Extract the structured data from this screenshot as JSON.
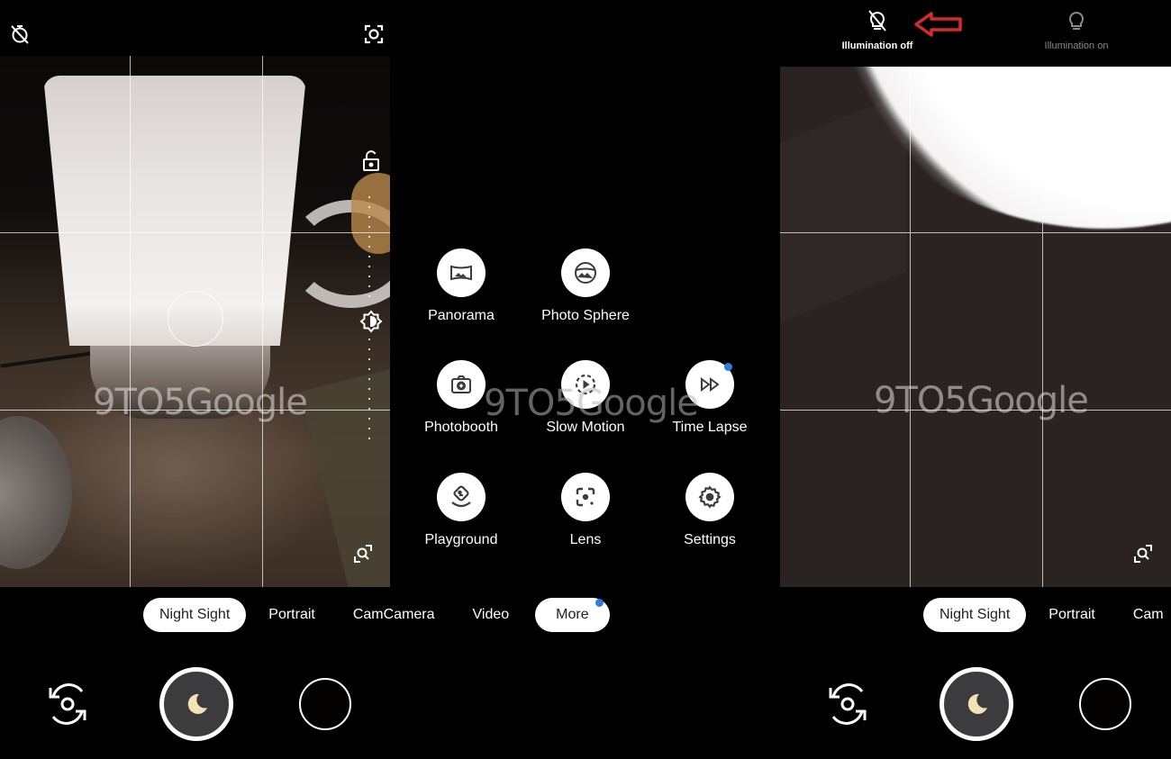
{
  "watermark": "9TO5Google",
  "left_panel": {
    "top_icons": [
      "timer-off-icon",
      "lens-scan-icon"
    ],
    "side_icons": [
      "exposure-lock-icon",
      "brightness-icon",
      "zoom-search-icon"
    ]
  },
  "more_panel": {
    "modes": [
      {
        "label": "Panorama",
        "icon": "panorama-icon",
        "new_badge": false
      },
      {
        "label": "Photo Sphere",
        "icon": "photo-sphere-icon",
        "new_badge": false
      },
      {
        "label": "Photobooth",
        "icon": "photobooth-icon",
        "new_badge": false
      },
      {
        "label": "Slow Motion",
        "icon": "slow-motion-icon",
        "new_badge": false
      },
      {
        "label": "Time Lapse",
        "icon": "time-lapse-icon",
        "new_badge": true
      },
      {
        "label": "Playground",
        "icon": "playground-icon",
        "new_badge": false
      },
      {
        "label": "Lens",
        "icon": "lens-icon",
        "new_badge": false
      },
      {
        "label": "Settings",
        "icon": "settings-icon",
        "new_badge": false
      }
    ]
  },
  "mode_tabs": {
    "items": [
      "Night Sight",
      "Portrait",
      "CamCamera",
      "Video",
      "More"
    ],
    "active": "Night Sight",
    "more_has_badge": true
  },
  "right_panel": {
    "illumination_off_label": "Illumination off",
    "illumination_on_label": "Illumination on",
    "selected": "Illumination off",
    "mode_tabs": [
      "Night Sight",
      "Portrait",
      "Cam"
    ]
  },
  "colors": {
    "accent_blue": "#2f7bdf",
    "annotation_red": "#d62a2a",
    "moon": "#f3e2b5",
    "shutter_fill": "#3c3c3e"
  }
}
